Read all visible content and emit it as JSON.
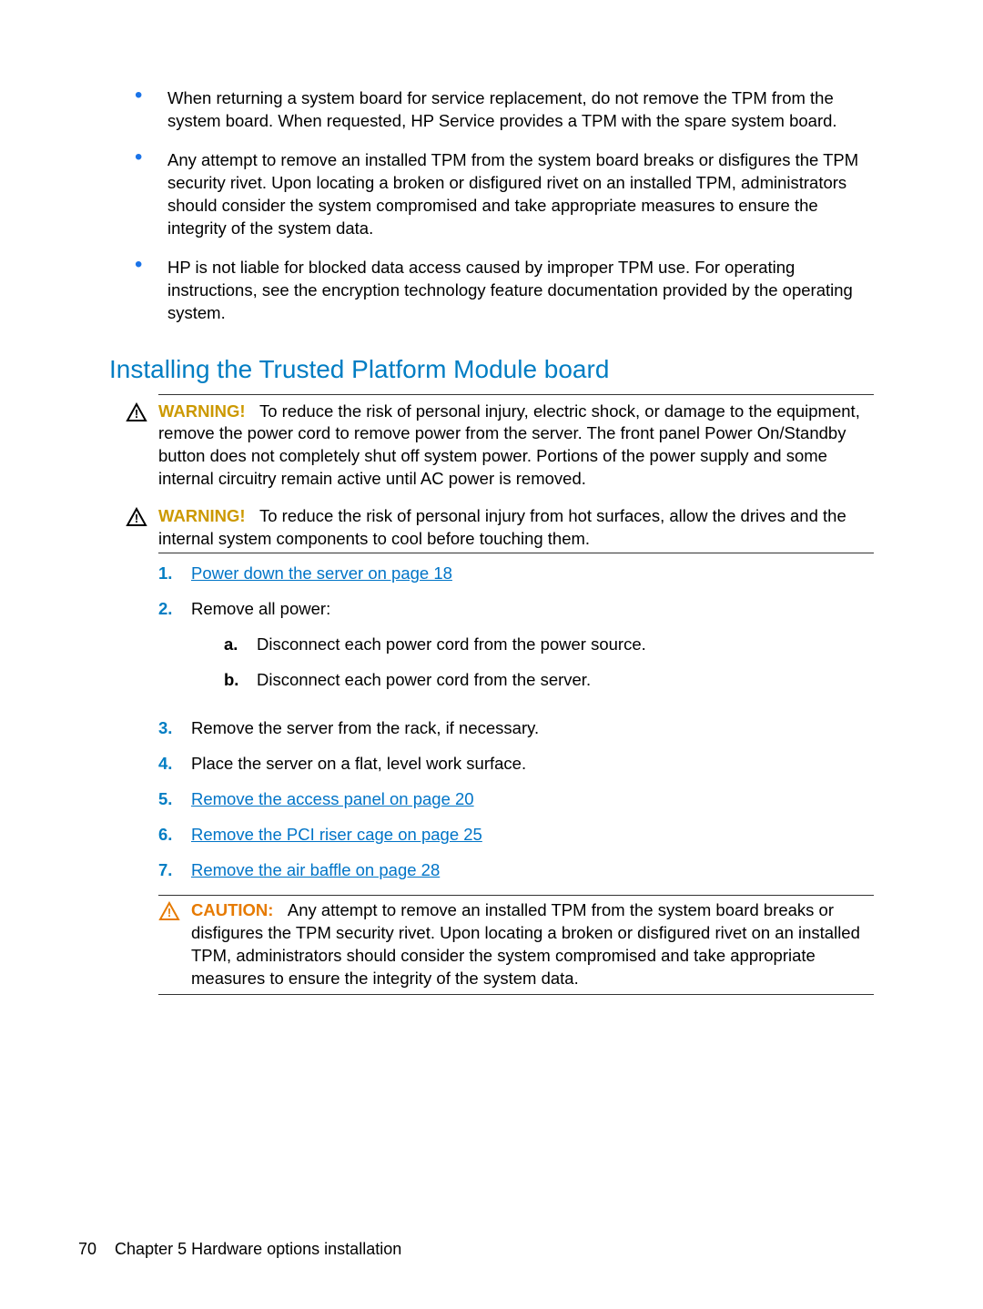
{
  "bullets": [
    "When returning a system board for service replacement, do not remove the TPM from the system board. When requested, HP Service provides a TPM with the spare system board.",
    "Any attempt to remove an installed TPM from the system board breaks or disfigures the TPM security rivet. Upon locating a broken or disfigured rivet on an installed TPM, administrators should consider the system compromised and take appropriate measures to ensure the integrity of the system data.",
    "HP is not liable for blocked data access caused by improper TPM use. For operating instructions, see the encryption technology feature documentation provided by the operating system."
  ],
  "section_heading": "Installing the Trusted Platform Module board",
  "warning1": {
    "label": "WARNING!",
    "text": "To reduce the risk of personal injury, electric shock, or damage to the equipment, remove the power cord to remove power from the server. The front panel Power On/Standby button does not completely shut off system power. Portions of the power supply and some internal circuitry remain active until AC power is removed."
  },
  "warning2": {
    "label": "WARNING!",
    "text": "To reduce the risk of personal injury from hot surfaces, allow the drives and the internal system components to cool before touching them."
  },
  "steps": {
    "s1_link": "Power down the server on page 18",
    "s2": "Remove all power:",
    "s2a": "Disconnect each power cord from the power source.",
    "s2b": "Disconnect each power cord from the server.",
    "s3": "Remove the server from the rack, if necessary.",
    "s4": "Place the server on a flat, level work surface.",
    "s5_link": "Remove the access panel on page 20",
    "s6_link": "Remove the PCI riser cage on page 25",
    "s7_link": "Remove the air baffle on page 28"
  },
  "caution": {
    "label": "CAUTION:",
    "text": "Any attempt to remove an installed TPM from the system board breaks or disfigures the TPM security rivet. Upon locating a broken or disfigured rivet on an installed TPM, administrators should consider the system compromised and take appropriate measures to ensure the integrity of the system data."
  },
  "footer": {
    "page": "70",
    "chapter": "Chapter 5   Hardware options installation"
  }
}
